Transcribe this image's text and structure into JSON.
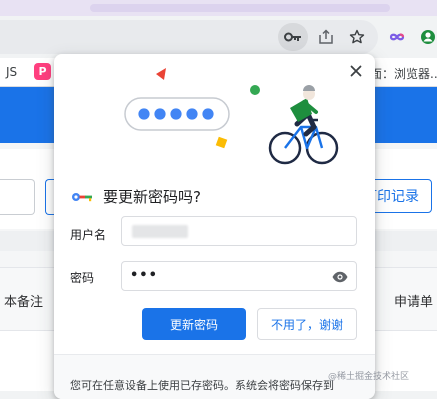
{
  "bookmarks": {
    "left_text": "JS",
    "p_icon_letter": "P",
    "right_text": "面：浏览器.."
  },
  "toolbar": {
    "key_icon": "key-icon",
    "share_icon": "share-icon",
    "star_icon": "star-icon",
    "ext_icon": "infinity-extension-icon",
    "account_icon": "account-icon"
  },
  "page": {
    "print_button": "打印记录",
    "column_left": "本备注",
    "column_right": "申请单"
  },
  "popup": {
    "title": "要更新密码吗?",
    "username_label": "用户名",
    "password_label": "密码",
    "password_value": "•••",
    "update_button": "更新密码",
    "no_thanks_button": "不用了，谢谢",
    "footer_text": "您可在任意设备上使用已存密码。系统会将密码保存到"
  },
  "watermark": "@稀土掘金技术社区",
  "colors": {
    "accent": "#1a73e8",
    "chrome_bg": "#f1f3f4"
  }
}
